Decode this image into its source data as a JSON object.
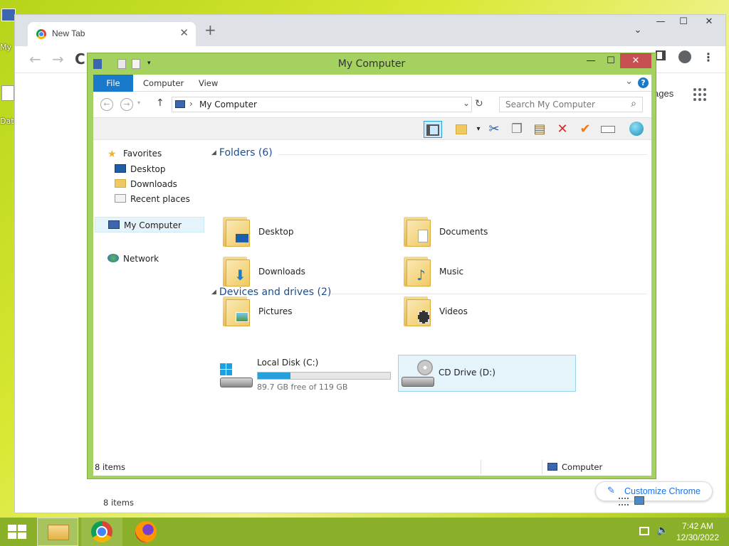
{
  "desktop": {
    "icon1_label": "My",
    "icon2_label": "Dat"
  },
  "chrome": {
    "tab_title": "New Tab",
    "tab_close": "✕",
    "new_tab": "+",
    "controls": {
      "chevron": "⌄",
      "minimize": "—",
      "maximize": "☐",
      "close": "✕"
    },
    "nav": {
      "back": "←",
      "forward": "→",
      "reload": "C"
    },
    "partial_link_text": "ages",
    "customize_label": "Customize Chrome",
    "customize_icon": "✎"
  },
  "explorer": {
    "title": "My Computer",
    "controls": {
      "minimize": "—",
      "maximize": "☐",
      "close": "✕"
    },
    "ribbon": {
      "tabs": [
        "File",
        "Computer",
        "View"
      ],
      "expand": "⌄",
      "help": "?"
    },
    "address": {
      "path": "My Computer",
      "breadcrumb_arrow": "›",
      "dropdown": "⌄",
      "refresh": "↻",
      "up": "↑"
    },
    "search": {
      "placeholder": "Search My Computer",
      "icon": "⌕"
    },
    "nav_pane": {
      "favorites": "Favorites",
      "favorites_items": [
        "Desktop",
        "Downloads",
        "Recent places"
      ],
      "my_computer": "My Computer",
      "network": "Network"
    },
    "groups": {
      "folders_header": "Folders (6)",
      "devices_header": "Devices and drives (2)"
    },
    "folders": [
      "Desktop",
      "Documents",
      "Downloads",
      "Music",
      "Pictures",
      "Videos"
    ],
    "drives": [
      {
        "label": "Local Disk (C:)",
        "free_text": "89.7 GB free of 119 GB",
        "used_fraction": 0.246
      },
      {
        "label": "CD Drive (D:)"
      }
    ],
    "status_inner": "8 items",
    "status_bar": {
      "items": "8 items",
      "location": "Computer"
    }
  },
  "taskbar": {
    "time": "7:42 AM",
    "date": "12/30/2022"
  },
  "colors": {
    "window_frame": "#a5d160",
    "close_button": "#c75050",
    "file_tab": "#1979ca",
    "accent_blue": "#1a73e8",
    "taskbar": "#8ab02a",
    "selected_drive": "#cce8ff"
  }
}
